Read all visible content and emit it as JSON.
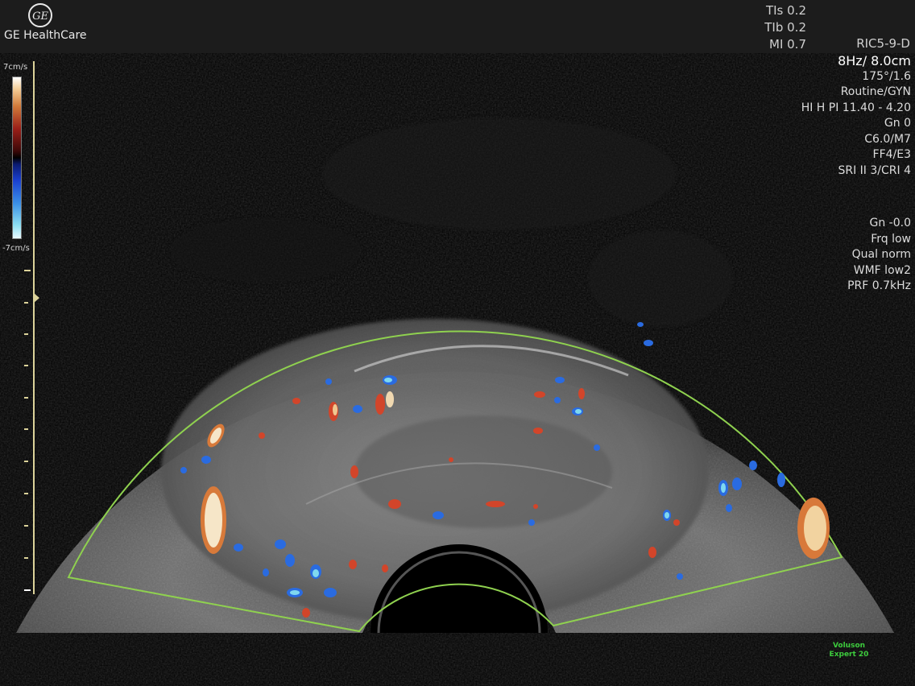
{
  "brand": {
    "text": "GE HealthCare"
  },
  "safety": {
    "tis": "TIs 0.2",
    "tib": "TIb 0.2",
    "mi": "MI 0.7"
  },
  "probe": "RIC5-9-D",
  "params": [
    {
      "text": "8Hz/ 8.0cm",
      "emphasis": true
    },
    {
      "text": "175°/1.6"
    },
    {
      "text": "Routine/GYN"
    },
    {
      "text": "HI H PI 11.40 - 4.20"
    },
    {
      "text": "Gn   0"
    },
    {
      "text": "C6.0/M7"
    },
    {
      "text": "FF4/E3"
    },
    {
      "text": "SRI II 3/CRI 4"
    }
  ],
  "color_params": [
    {
      "text": "Gn -0.0"
    },
    {
      "text": "Frq low"
    },
    {
      "text": "Qual norm"
    },
    {
      "text": "WMF low2"
    },
    {
      "text": "PRF  0.7kHz"
    }
  ],
  "colorbar": {
    "top_label": "7cm/s",
    "bottom_label": "-7cm/s"
  },
  "footer": {
    "line1": "Voluson",
    "line2": "Expert 20"
  },
  "colors": {
    "roi_outline": "#8fd14f",
    "depth_scale": "#dcd39a",
    "brand_accent": "#3dcb3d"
  }
}
